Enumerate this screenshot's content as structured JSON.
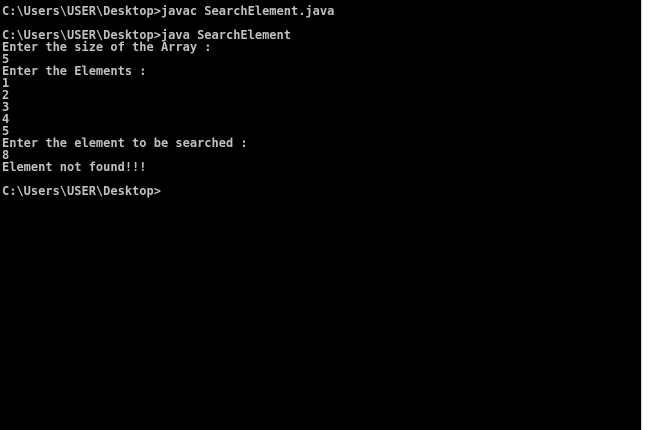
{
  "console": {
    "lines": [
      "C:\\Users\\USER\\Desktop>javac SearchElement.java",
      "",
      "C:\\Users\\USER\\Desktop>java SearchElement",
      "Enter the size of the Array :",
      "5",
      "Enter the Elements :",
      "1",
      "2",
      "3",
      "4",
      "5",
      "Enter the element to be searched :",
      "8",
      "Element not found!!!",
      "",
      "C:\\Users\\USER\\Desktop>"
    ]
  },
  "colors": {
    "background": "#000000",
    "text": "#c0c0c0",
    "scrollbar": "#ffffff"
  }
}
